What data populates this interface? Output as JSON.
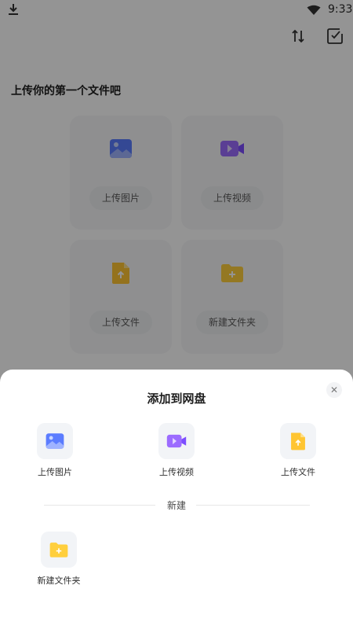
{
  "status_bar": {
    "time": "9:33"
  },
  "page": {
    "empty_title": "上传你的第一个文件吧",
    "cards": [
      {
        "label": "上传图片",
        "icon": "image-icon"
      },
      {
        "label": "上传视频",
        "icon": "video-icon"
      },
      {
        "label": "上传文件",
        "icon": "file-upload-icon"
      },
      {
        "label": "新建文件夹",
        "icon": "folder-add-icon"
      }
    ]
  },
  "sheet": {
    "title": "添加到网盘",
    "close_icon": "close-icon",
    "actions": [
      {
        "label": "上传图片",
        "icon": "image-icon"
      },
      {
        "label": "上传视频",
        "icon": "video-icon"
      },
      {
        "label": "上传文件",
        "icon": "file-upload-icon"
      }
    ],
    "new_section_label": "新建",
    "new_items": [
      {
        "label": "新建文件夹",
        "icon": "folder-add-icon"
      }
    ]
  },
  "colors": {
    "image_blue": "#5b7cff",
    "video_purple": "#9c6bff",
    "file_yellow": "#ffc532",
    "folder_yellow": "#ffcf3d"
  }
}
